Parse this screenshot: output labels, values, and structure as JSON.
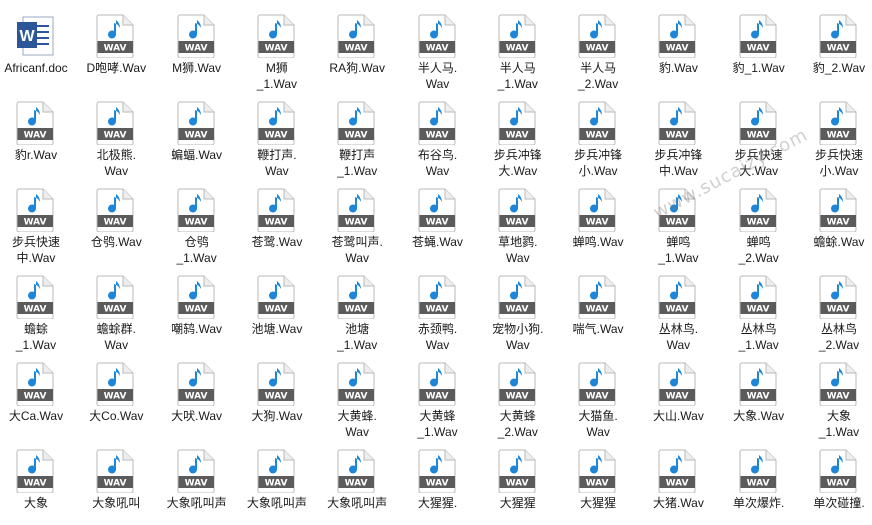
{
  "files": [
    {
      "name": "Africanf.doc",
      "type": "doc"
    },
    {
      "name": "D咆哮.Wav",
      "type": "wav"
    },
    {
      "name": "M狮.Wav",
      "type": "wav"
    },
    {
      "name": "M狮\n_1.Wav",
      "type": "wav"
    },
    {
      "name": "RA狗.Wav",
      "type": "wav"
    },
    {
      "name": "半人马.\nWav",
      "type": "wav"
    },
    {
      "name": "半人马\n_1.Wav",
      "type": "wav"
    },
    {
      "name": "半人马\n_2.Wav",
      "type": "wav"
    },
    {
      "name": "豹.Wav",
      "type": "wav"
    },
    {
      "name": "豹_1.Wav",
      "type": "wav"
    },
    {
      "name": "豹_2.Wav",
      "type": "wav"
    },
    {
      "name": "豹r.Wav",
      "type": "wav"
    },
    {
      "name": "北极熊.\nWav",
      "type": "wav"
    },
    {
      "name": "蝙蝠.Wav",
      "type": "wav"
    },
    {
      "name": "鞭打声.\nWav",
      "type": "wav"
    },
    {
      "name": "鞭打声\n_1.Wav",
      "type": "wav"
    },
    {
      "name": "布谷鸟.\nWav",
      "type": "wav"
    },
    {
      "name": "步兵冲锋\n大.Wav",
      "type": "wav"
    },
    {
      "name": "步兵冲锋\n小.Wav",
      "type": "wav"
    },
    {
      "name": "步兵冲锋\n中.Wav",
      "type": "wav"
    },
    {
      "name": "步兵快速\n大.Wav",
      "type": "wav"
    },
    {
      "name": "步兵快速\n小.Wav",
      "type": "wav"
    },
    {
      "name": "步兵快速\n中.Wav",
      "type": "wav"
    },
    {
      "name": "仓鸮.Wav",
      "type": "wav"
    },
    {
      "name": "仓鸮\n_1.Wav",
      "type": "wav"
    },
    {
      "name": "苍鹭.Wav",
      "type": "wav"
    },
    {
      "name": "苍鹭叫声.\nWav",
      "type": "wav"
    },
    {
      "name": "苍蝇.Wav",
      "type": "wav"
    },
    {
      "name": "草地鹨.\nWav",
      "type": "wav"
    },
    {
      "name": "蝉鸣.Wav",
      "type": "wav"
    },
    {
      "name": "蝉鸣\n_1.Wav",
      "type": "wav"
    },
    {
      "name": "蝉鸣\n_2.Wav",
      "type": "wav"
    },
    {
      "name": "蟾蜍.Wav",
      "type": "wav"
    },
    {
      "name": "蟾蜍\n_1.Wav",
      "type": "wav"
    },
    {
      "name": "蟾蜍群.\nWav",
      "type": "wav"
    },
    {
      "name": "嘲鸫.Wav",
      "type": "wav"
    },
    {
      "name": "池塘.Wav",
      "type": "wav"
    },
    {
      "name": "池塘\n_1.Wav",
      "type": "wav"
    },
    {
      "name": "赤颈鸭.\nWav",
      "type": "wav"
    },
    {
      "name": "宠物小狗.\nWav",
      "type": "wav"
    },
    {
      "name": "喘气.Wav",
      "type": "wav"
    },
    {
      "name": "丛林鸟.\nWav",
      "type": "wav"
    },
    {
      "name": "丛林鸟\n_1.Wav",
      "type": "wav"
    },
    {
      "name": "丛林鸟\n_2.Wav",
      "type": "wav"
    },
    {
      "name": "大Ca.Wav",
      "type": "wav"
    },
    {
      "name": "大Co.Wav",
      "type": "wav"
    },
    {
      "name": "大吠.Wav",
      "type": "wav"
    },
    {
      "name": "大狗.Wav",
      "type": "wav"
    },
    {
      "name": "大黄蜂.\nWav",
      "type": "wav"
    },
    {
      "name": "大黄蜂\n_1.Wav",
      "type": "wav"
    },
    {
      "name": "大黄蜂\n_2.Wav",
      "type": "wav"
    },
    {
      "name": "大猫鱼.\nWav",
      "type": "wav"
    },
    {
      "name": "大山.Wav",
      "type": "wav"
    },
    {
      "name": "大象.Wav",
      "type": "wav"
    },
    {
      "name": "大象\n_1.Wav",
      "type": "wav"
    },
    {
      "name": "大象",
      "type": "wav"
    },
    {
      "name": "大象吼叫",
      "type": "wav"
    },
    {
      "name": "大象吼叫声",
      "type": "wav"
    },
    {
      "name": "大象吼叫声",
      "type": "wav"
    },
    {
      "name": "大象吼叫声",
      "type": "wav"
    },
    {
      "name": "大猩猩.",
      "type": "wav"
    },
    {
      "name": "大猩猩",
      "type": "wav"
    },
    {
      "name": "大猩猩",
      "type": "wav"
    },
    {
      "name": "大猪.Wav",
      "type": "wav"
    },
    {
      "name": "单次爆炸.",
      "type": "wav"
    },
    {
      "name": "单次碰撞.",
      "type": "wav"
    }
  ],
  "icons": {
    "wav_label": "WAV",
    "doc_label": "W"
  },
  "colors": {
    "wav_note": "#1e86d8",
    "doc_blue": "#2b579a"
  },
  "watermark": "www.sucaizy.com"
}
